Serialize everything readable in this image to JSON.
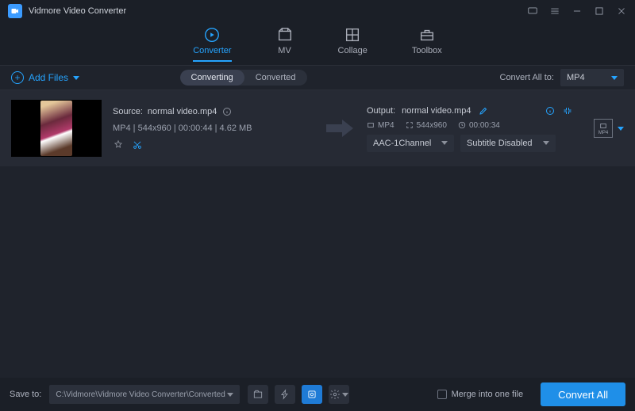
{
  "app_title": "Vidmore Video Converter",
  "tabs": {
    "converter": "Converter",
    "mv": "MV",
    "collage": "Collage",
    "toolbox": "Toolbox"
  },
  "toolbar": {
    "add_files": "Add Files",
    "seg_converting": "Converting",
    "seg_converted": "Converted",
    "convert_all_to": "Convert All to:",
    "format_selected": "MP4"
  },
  "item": {
    "source_label": "Source:",
    "source_name": "normal video.mp4",
    "meta": "MP4 | 544x960 | 00:00:44 | 4.62 MB",
    "output_label": "Output:",
    "output_name": "normal video.mp4",
    "out_fmt": "MP4",
    "out_res": "544x960",
    "out_dur": "00:00:34",
    "audio_select": "AAC-1Channel",
    "subtitle_select": "Subtitle Disabled",
    "fmt_badge": "MP4"
  },
  "footer": {
    "save_to_label": "Save to:",
    "save_path": "C:\\Vidmore\\Vidmore Video Converter\\Converted",
    "merge_label": "Merge into one file",
    "convert_btn": "Convert All"
  },
  "colors": {
    "accent": "#25a4ff",
    "button": "#1f8fe8"
  }
}
